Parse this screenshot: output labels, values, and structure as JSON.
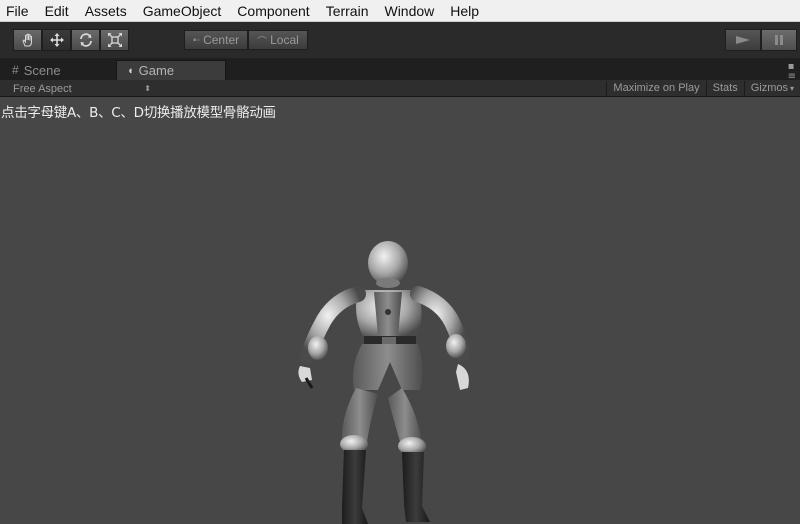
{
  "menu": {
    "items": [
      "File",
      "Edit",
      "Assets",
      "GameObject",
      "Component",
      "Terrain",
      "Window",
      "Help"
    ]
  },
  "toolbar": {
    "tools": [
      "hand-icon",
      "move-icon",
      "rotate-icon",
      "scale-icon"
    ],
    "active_tool": "move-icon",
    "pivot_label": "Center",
    "space_label": "Local"
  },
  "tabs": {
    "scene_label": "Scene",
    "game_label": "Game",
    "selected": "Game"
  },
  "game_view": {
    "aspect_label": "Free Aspect",
    "maximize_label": "Maximize on Play",
    "stats_label": "Stats",
    "gizmos_label": "Gizmos",
    "hint_text": "点击字母键A、B、C、D切换播放模型骨骼动画"
  }
}
